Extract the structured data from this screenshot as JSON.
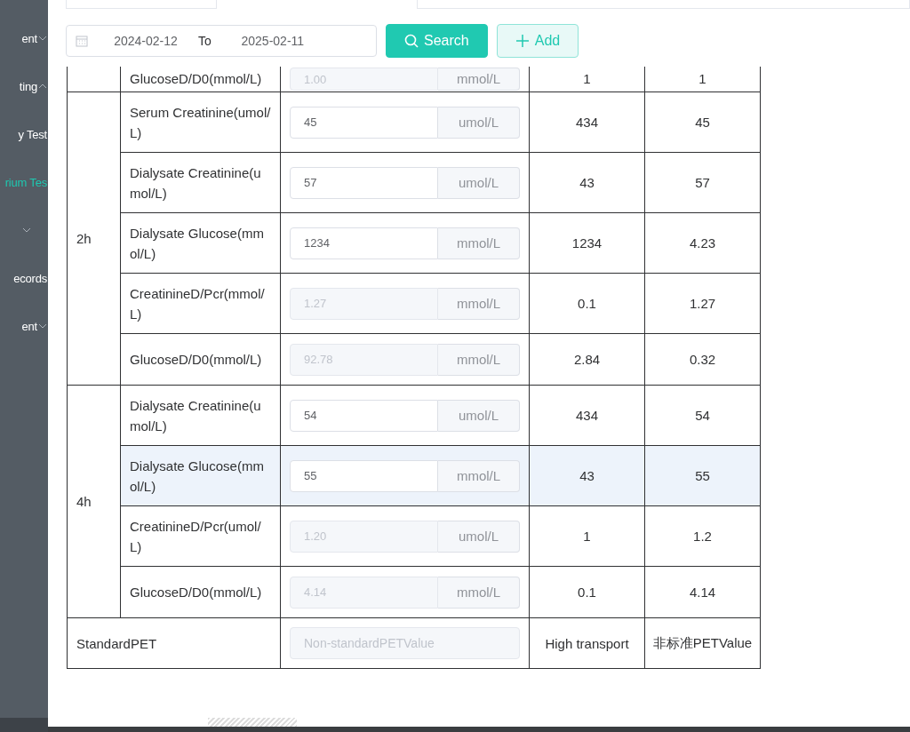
{
  "sidebar": {
    "items": [
      {
        "kind": "submenu",
        "label": "ent",
        "selected": false,
        "expanded": false
      },
      {
        "kind": "submenu",
        "label": "ting",
        "selected": false,
        "expanded": true
      },
      {
        "kind": "link",
        "label": "y Test",
        "selected": false
      },
      {
        "kind": "link",
        "label": "rium Tes",
        "selected": true
      },
      {
        "kind": "submenu",
        "selected": false,
        "expanded": false
      },
      {
        "kind": "link",
        "label": "ecords",
        "selected": false
      },
      {
        "kind": "submenu",
        "label": "ent",
        "selected": false,
        "expanded": false
      }
    ]
  },
  "toolbar": {
    "date_range": {
      "start": "2024-02-12",
      "separator": "To",
      "end": "2025-02-11"
    },
    "buttons": [
      {
        "label": "Search",
        "kind": "primary"
      },
      {
        "label": "Add",
        "kind": "plain"
      }
    ]
  },
  "table": {
    "groups": [
      {
        "rows": [
          {
            "name": "GlucoseD/D0(mmol/L)",
            "value": "1.00",
            "unit": "mmol/L",
            "disabled": true,
            "highlighted": false,
            "column_4": "1",
            "column_5": "1"
          }
        ]
      },
      {
        "label": "2h",
        "rows": [
          {
            "name": "Serum Creatinine(umol/L)",
            "value": "45",
            "unit": "umol/L",
            "disabled": false,
            "highlighted": false,
            "column_4": "434",
            "column_5": "45"
          },
          {
            "name": "Dialysate Creatinine(umol/L)",
            "value": "57",
            "unit": "umol/L",
            "disabled": false,
            "highlighted": false,
            "column_4": "43",
            "column_5": "57"
          },
          {
            "name": "Dialysate Glucose(mmol/L)",
            "value": "1234",
            "unit": "mmol/L",
            "disabled": false,
            "highlighted": false,
            "column_4": "1234",
            "column_5": "4.23"
          },
          {
            "name": "CreatinineD/Pcr(mmol/L)",
            "value": "1.27",
            "unit": "mmol/L",
            "disabled": true,
            "highlighted": false,
            "column_4": "0.1",
            "column_5": "1.27"
          },
          {
            "name": "GlucoseD/D0(mmol/L)",
            "value": "92.78",
            "unit": "mmol/L",
            "disabled": true,
            "highlighted": false,
            "column_4": "2.84",
            "column_5": "0.32"
          }
        ]
      },
      {
        "label": "4h",
        "rows": [
          {
            "name": "Dialysate Creatinine(umol/L)",
            "value": "54",
            "unit": "umol/L",
            "disabled": false,
            "highlighted": false,
            "column_4": "434",
            "column_5": "54"
          },
          {
            "name": "Dialysate Glucose(mmol/L)",
            "value": "55",
            "unit": "mmol/L",
            "disabled": false,
            "highlighted": true,
            "column_4": "43",
            "column_5": "55"
          },
          {
            "name": "CreatinineD/Pcr(umol/L)",
            "value": "1.20",
            "unit": "umol/L",
            "disabled": true,
            "highlighted": false,
            "column_4": "1",
            "column_5": "1.2"
          },
          {
            "name": "GlucoseD/D0(mmol/L)",
            "value": "4.14",
            "unit": "mmol/L",
            "disabled": true,
            "highlighted": false,
            "column_4": "0.1",
            "column_5": "4.14"
          }
        ]
      }
    ],
    "footer": {
      "label": "StandardPET",
      "placeholder": "Non-standardPETValue",
      "disabled": true,
      "column_4": "High transport",
      "column_5": "非标准PETValue"
    }
  }
}
